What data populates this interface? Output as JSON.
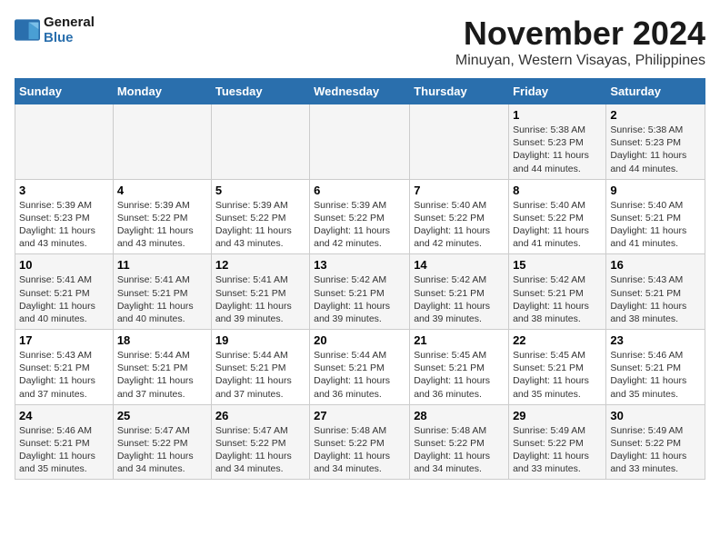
{
  "header": {
    "logo_line1": "General",
    "logo_line2": "Blue",
    "month": "November 2024",
    "location": "Minuyan, Western Visayas, Philippines"
  },
  "weekdays": [
    "Sunday",
    "Monday",
    "Tuesday",
    "Wednesday",
    "Thursday",
    "Friday",
    "Saturday"
  ],
  "weeks": [
    [
      {
        "day": "",
        "info": ""
      },
      {
        "day": "",
        "info": ""
      },
      {
        "day": "",
        "info": ""
      },
      {
        "day": "",
        "info": ""
      },
      {
        "day": "",
        "info": ""
      },
      {
        "day": "1",
        "info": "Sunrise: 5:38 AM\nSunset: 5:23 PM\nDaylight: 11 hours and 44 minutes."
      },
      {
        "day": "2",
        "info": "Sunrise: 5:38 AM\nSunset: 5:23 PM\nDaylight: 11 hours and 44 minutes."
      }
    ],
    [
      {
        "day": "3",
        "info": "Sunrise: 5:39 AM\nSunset: 5:23 PM\nDaylight: 11 hours and 43 minutes."
      },
      {
        "day": "4",
        "info": "Sunrise: 5:39 AM\nSunset: 5:22 PM\nDaylight: 11 hours and 43 minutes."
      },
      {
        "day": "5",
        "info": "Sunrise: 5:39 AM\nSunset: 5:22 PM\nDaylight: 11 hours and 43 minutes."
      },
      {
        "day": "6",
        "info": "Sunrise: 5:39 AM\nSunset: 5:22 PM\nDaylight: 11 hours and 42 minutes."
      },
      {
        "day": "7",
        "info": "Sunrise: 5:40 AM\nSunset: 5:22 PM\nDaylight: 11 hours and 42 minutes."
      },
      {
        "day": "8",
        "info": "Sunrise: 5:40 AM\nSunset: 5:22 PM\nDaylight: 11 hours and 41 minutes."
      },
      {
        "day": "9",
        "info": "Sunrise: 5:40 AM\nSunset: 5:21 PM\nDaylight: 11 hours and 41 minutes."
      }
    ],
    [
      {
        "day": "10",
        "info": "Sunrise: 5:41 AM\nSunset: 5:21 PM\nDaylight: 11 hours and 40 minutes."
      },
      {
        "day": "11",
        "info": "Sunrise: 5:41 AM\nSunset: 5:21 PM\nDaylight: 11 hours and 40 minutes."
      },
      {
        "day": "12",
        "info": "Sunrise: 5:41 AM\nSunset: 5:21 PM\nDaylight: 11 hours and 39 minutes."
      },
      {
        "day": "13",
        "info": "Sunrise: 5:42 AM\nSunset: 5:21 PM\nDaylight: 11 hours and 39 minutes."
      },
      {
        "day": "14",
        "info": "Sunrise: 5:42 AM\nSunset: 5:21 PM\nDaylight: 11 hours and 39 minutes."
      },
      {
        "day": "15",
        "info": "Sunrise: 5:42 AM\nSunset: 5:21 PM\nDaylight: 11 hours and 38 minutes."
      },
      {
        "day": "16",
        "info": "Sunrise: 5:43 AM\nSunset: 5:21 PM\nDaylight: 11 hours and 38 minutes."
      }
    ],
    [
      {
        "day": "17",
        "info": "Sunrise: 5:43 AM\nSunset: 5:21 PM\nDaylight: 11 hours and 37 minutes."
      },
      {
        "day": "18",
        "info": "Sunrise: 5:44 AM\nSunset: 5:21 PM\nDaylight: 11 hours and 37 minutes."
      },
      {
        "day": "19",
        "info": "Sunrise: 5:44 AM\nSunset: 5:21 PM\nDaylight: 11 hours and 37 minutes."
      },
      {
        "day": "20",
        "info": "Sunrise: 5:44 AM\nSunset: 5:21 PM\nDaylight: 11 hours and 36 minutes."
      },
      {
        "day": "21",
        "info": "Sunrise: 5:45 AM\nSunset: 5:21 PM\nDaylight: 11 hours and 36 minutes."
      },
      {
        "day": "22",
        "info": "Sunrise: 5:45 AM\nSunset: 5:21 PM\nDaylight: 11 hours and 35 minutes."
      },
      {
        "day": "23",
        "info": "Sunrise: 5:46 AM\nSunset: 5:21 PM\nDaylight: 11 hours and 35 minutes."
      }
    ],
    [
      {
        "day": "24",
        "info": "Sunrise: 5:46 AM\nSunset: 5:21 PM\nDaylight: 11 hours and 35 minutes."
      },
      {
        "day": "25",
        "info": "Sunrise: 5:47 AM\nSunset: 5:22 PM\nDaylight: 11 hours and 34 minutes."
      },
      {
        "day": "26",
        "info": "Sunrise: 5:47 AM\nSunset: 5:22 PM\nDaylight: 11 hours and 34 minutes."
      },
      {
        "day": "27",
        "info": "Sunrise: 5:48 AM\nSunset: 5:22 PM\nDaylight: 11 hours and 34 minutes."
      },
      {
        "day": "28",
        "info": "Sunrise: 5:48 AM\nSunset: 5:22 PM\nDaylight: 11 hours and 34 minutes."
      },
      {
        "day": "29",
        "info": "Sunrise: 5:49 AM\nSunset: 5:22 PM\nDaylight: 11 hours and 33 minutes."
      },
      {
        "day": "30",
        "info": "Sunrise: 5:49 AM\nSunset: 5:22 PM\nDaylight: 11 hours and 33 minutes."
      }
    ]
  ]
}
